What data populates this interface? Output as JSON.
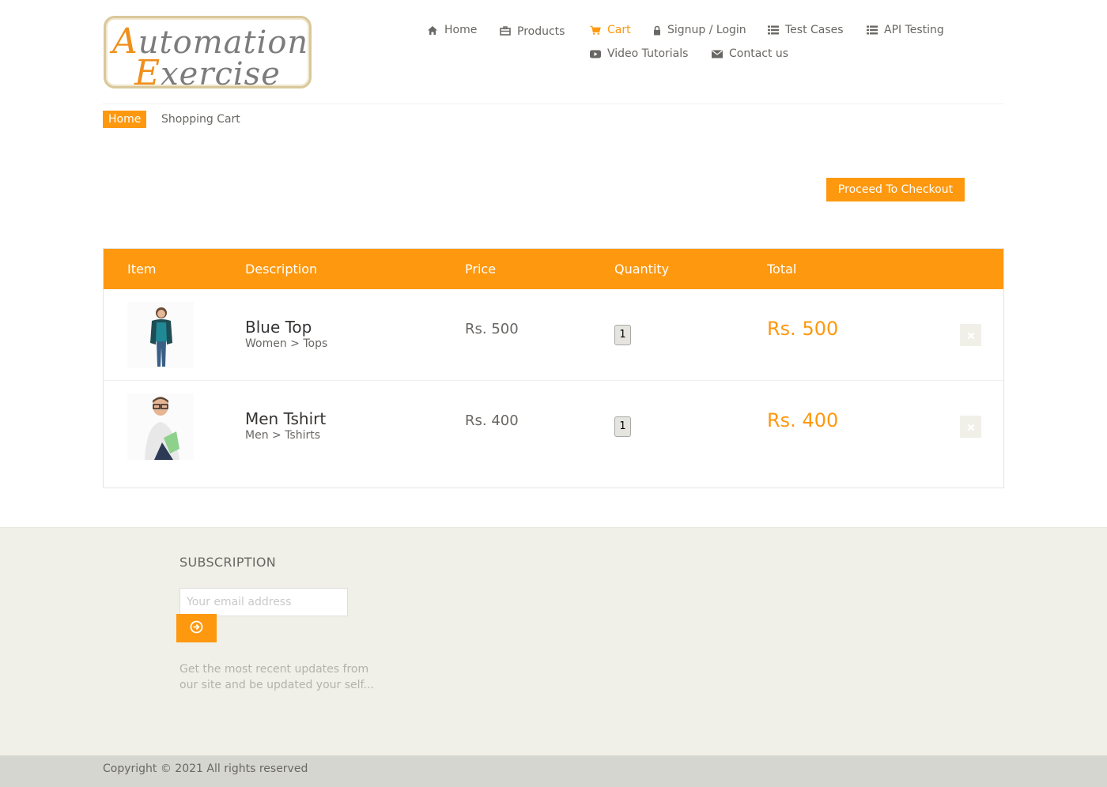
{
  "header": {
    "logo": {
      "line1": "Automation",
      "line2": "Exercise"
    },
    "nav": [
      {
        "label": "Home",
        "icon": "home-icon"
      },
      {
        "label": "Products",
        "icon": "products-icon"
      },
      {
        "label": "Cart",
        "icon": "cart-icon",
        "active": true
      },
      {
        "label": "Signup / Login",
        "icon": "lock-icon"
      },
      {
        "label": "Test Cases",
        "icon": "list-icon"
      },
      {
        "label": "API Testing",
        "icon": "list-icon"
      },
      {
        "label": "Video Tutorials",
        "icon": "youtube-icon"
      },
      {
        "label": "Contact us",
        "icon": "envelope-icon"
      }
    ]
  },
  "breadcrumb": {
    "home": "Home",
    "current": "Shopping Cart"
  },
  "checkout_label": "Proceed To Checkout",
  "cart": {
    "headers": [
      "Item",
      "Description",
      "Price",
      "Quantity",
      "Total"
    ],
    "items": [
      {
        "name": "Blue Top",
        "category": "Women > Tops",
        "price": "Rs. 500",
        "quantity": "1",
        "total": "Rs. 500"
      },
      {
        "name": "Men Tshirt",
        "category": "Men > Tshirts",
        "price": "Rs. 400",
        "quantity": "1",
        "total": "Rs. 400"
      }
    ]
  },
  "footer": {
    "subscription_title": "SUBSCRIPTION",
    "email_placeholder": "Your email address",
    "subscription_text": "Get the most recent updates from our site and be updated your self...",
    "copyright": "Copyright © 2021 All rights reserved"
  },
  "colors": {
    "accent": "#fe980f",
    "text": "#696763",
    "footer_bg": "#f0f0e9"
  }
}
